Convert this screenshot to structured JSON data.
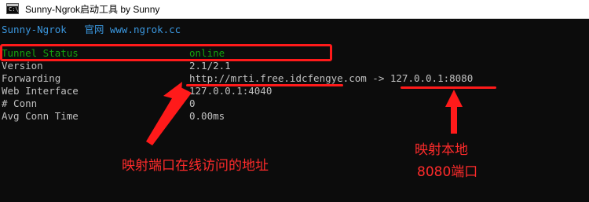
{
  "window": {
    "title": "Sunny-Ngrok启动工具 by Sunny",
    "icon": "cmd-icon"
  },
  "console": {
    "header": "Sunny-Ngrok   官网 www.ngrok.cc",
    "rows": [
      {
        "label": "Tunnel Status",
        "value": "online"
      },
      {
        "label": "Version",
        "value": "2.1/2.1"
      },
      {
        "label": "Forwarding",
        "value": "http://mrti.free.idcfengye.com -> 127.0.0.1:8080"
      },
      {
        "label": "Web Interface",
        "value": "127.0.0.1:4040"
      },
      {
        "label": "# Conn",
        "value": "0"
      },
      {
        "label": "Avg Conn Time",
        "value": "0.00ms"
      }
    ]
  },
  "annotations": {
    "online_url_note": "映射端口在线访问的地址",
    "local_port_note_line1": "映射本地",
    "local_port_note_line2": "8080端口"
  },
  "colors": {
    "annotation": "#ff1a1a",
    "header": "#3a96dd",
    "status": "#13a10e",
    "text": "#c0c0c0"
  }
}
